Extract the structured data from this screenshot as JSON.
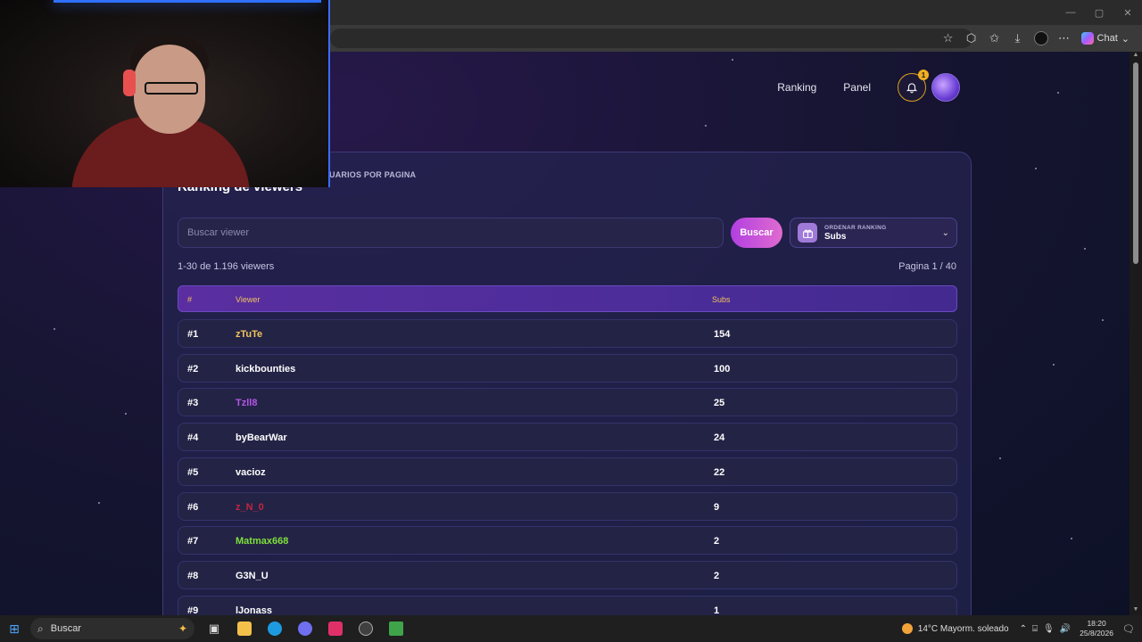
{
  "browser": {
    "window_controls": [
      "—",
      "▢",
      "✕"
    ],
    "copilot_label": "Chat"
  },
  "nav": {
    "ranking": "Ranking",
    "panel": "Panel",
    "notification_count": "1"
  },
  "panel": {
    "per_page_label": "UARIOS POR PAGINA",
    "title": "Ranking de viewers",
    "search_placeholder": "Buscar viewer",
    "search_button": "Buscar",
    "sort_label": "ORDENAR RANKING",
    "sort_value": "Subs",
    "count_text": "1-30 de 1.196 viewers",
    "pager_text": "Pagina 1 / 40",
    "headers": {
      "rank": "#",
      "viewer": "Viewer",
      "subs": "Subs"
    },
    "rows": [
      {
        "rank": "#1",
        "name": "zTuTe",
        "subs": "154",
        "color": "#f1c35a"
      },
      {
        "rank": "#2",
        "name": "kickbounties",
        "subs": "100",
        "color": "#ffffff"
      },
      {
        "rank": "#3",
        "name": "Tzll8",
        "subs": "25",
        "color": "#b455e6"
      },
      {
        "rank": "#4",
        "name": "byBearWar",
        "subs": "24",
        "color": "#ffffff"
      },
      {
        "rank": "#5",
        "name": "vacioz",
        "subs": "22",
        "color": "#ffffff"
      },
      {
        "rank": "#6",
        "name": "z_N_0",
        "subs": "9",
        "color": "#c02640"
      },
      {
        "rank": "#7",
        "name": "Matmax668",
        "subs": "2",
        "color": "#7fe03a"
      },
      {
        "rank": "#8",
        "name": "G3N_U",
        "subs": "2",
        "color": "#ffffff"
      },
      {
        "rank": "#9",
        "name": "lJonass",
        "subs": "1",
        "color": "#ffffff"
      }
    ]
  },
  "taskbar": {
    "search_label": "Buscar",
    "weather": "14°C  Mayorm. soleado",
    "time": "18:20",
    "date": "25/8/2026"
  }
}
